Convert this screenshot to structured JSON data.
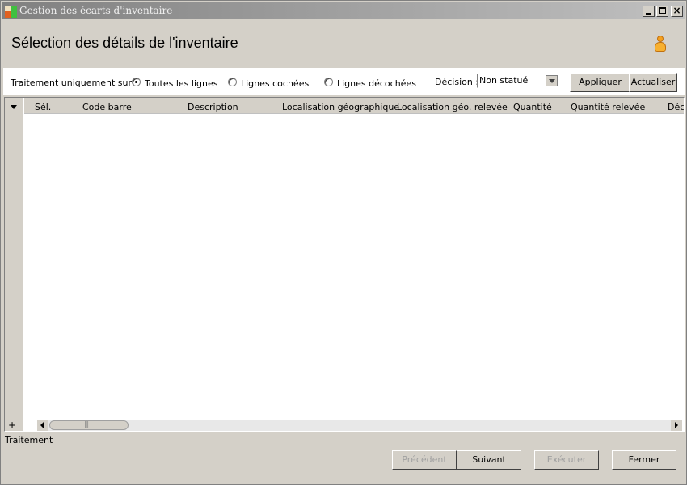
{
  "window": {
    "title": "Gestion des écarts d'inventaire",
    "minimize_glyph": "_",
    "close_glyph": "×"
  },
  "header": {
    "title": "Sélection des détails de l'inventaire",
    "user_icon": "user-icon"
  },
  "filter": {
    "label": "Traitement uniquement sur :",
    "options": [
      {
        "label": "Toutes les lignes",
        "checked": true
      },
      {
        "label": "Lignes cochées",
        "checked": false
      },
      {
        "label": "Lignes décochées",
        "checked": false
      }
    ],
    "decision_label": "Décision :",
    "decision_value": "Non statué",
    "apply_label": "Appliquer",
    "refresh_label": "Actualiser"
  },
  "grid": {
    "columns": [
      "Sél.",
      "Code barre",
      "Description",
      "Localisation géographique",
      "Localisation géo. relevée",
      "Quantité",
      "Quantité relevée",
      "Déc"
    ],
    "rows": [],
    "add_row_glyph": "+"
  },
  "status": {
    "label": "Traitement"
  },
  "footer": {
    "previous_label": "Précédent",
    "next_label": "Suivant",
    "execute_label": "Exécuter",
    "close_label": "Fermer"
  },
  "colors": {
    "window_bg": "#d4d0c8",
    "title_gradient_start": "#808080",
    "disabled_text": "#a0a0a0"
  }
}
